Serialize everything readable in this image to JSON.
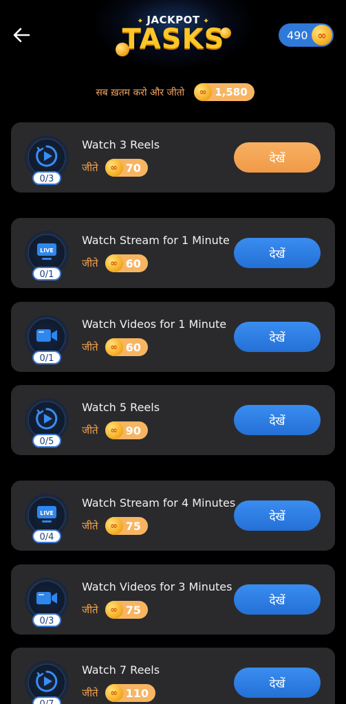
{
  "header": {
    "logo_top": "JACKPOT",
    "logo_main": "TASKS",
    "balance": "490",
    "back_icon": "arrow-left-icon",
    "coin_icon": "infinity-coin-icon"
  },
  "summary": {
    "label": "सब ख़तम करो और जीतो",
    "total": "1,580"
  },
  "tasks": [
    {
      "title": "Watch 3 Reels",
      "reward_label": "जीते",
      "reward": "70",
      "progress": "0/3",
      "button": "देखें",
      "icon": "reel-play-icon",
      "button_color": "orange"
    },
    {
      "title": "Watch Stream for 1 Minute",
      "reward_label": "जीते",
      "reward": "60",
      "progress": "0/1",
      "button": "देखें",
      "icon": "live-tv-icon",
      "button_color": "blue"
    },
    {
      "title": "Watch Videos for 1 Minute",
      "reward_label": "जीते",
      "reward": "60",
      "progress": "0/1",
      "button": "देखें",
      "icon": "video-camera-icon",
      "button_color": "blue"
    },
    {
      "title": "Watch 5 Reels",
      "reward_label": "जीते",
      "reward": "90",
      "progress": "0/5",
      "button": "देखें",
      "icon": "reel-play-icon",
      "button_color": "blue"
    },
    {
      "title": "Watch Stream for 4 Minutes",
      "reward_label": "जीते",
      "reward": "75",
      "progress": "0/4",
      "button": "देखें",
      "icon": "live-tv-icon",
      "button_color": "blue"
    },
    {
      "title": "Watch Videos for 3 Minutes",
      "reward_label": "जीते",
      "reward": "75",
      "progress": "0/3",
      "button": "देखें",
      "icon": "video-camera-icon",
      "button_color": "blue"
    },
    {
      "title": "Watch 7 Reels",
      "reward_label": "जीते",
      "reward": "110",
      "progress": "0/7",
      "button": "देखें",
      "icon": "reel-play-icon",
      "button_color": "blue"
    }
  ],
  "colors": {
    "background": "#000000",
    "card": "#2a2a2d",
    "accent_blue": "#2f79d9",
    "accent_orange": "#f6a44d",
    "coin_gold": "#f7b02a"
  }
}
